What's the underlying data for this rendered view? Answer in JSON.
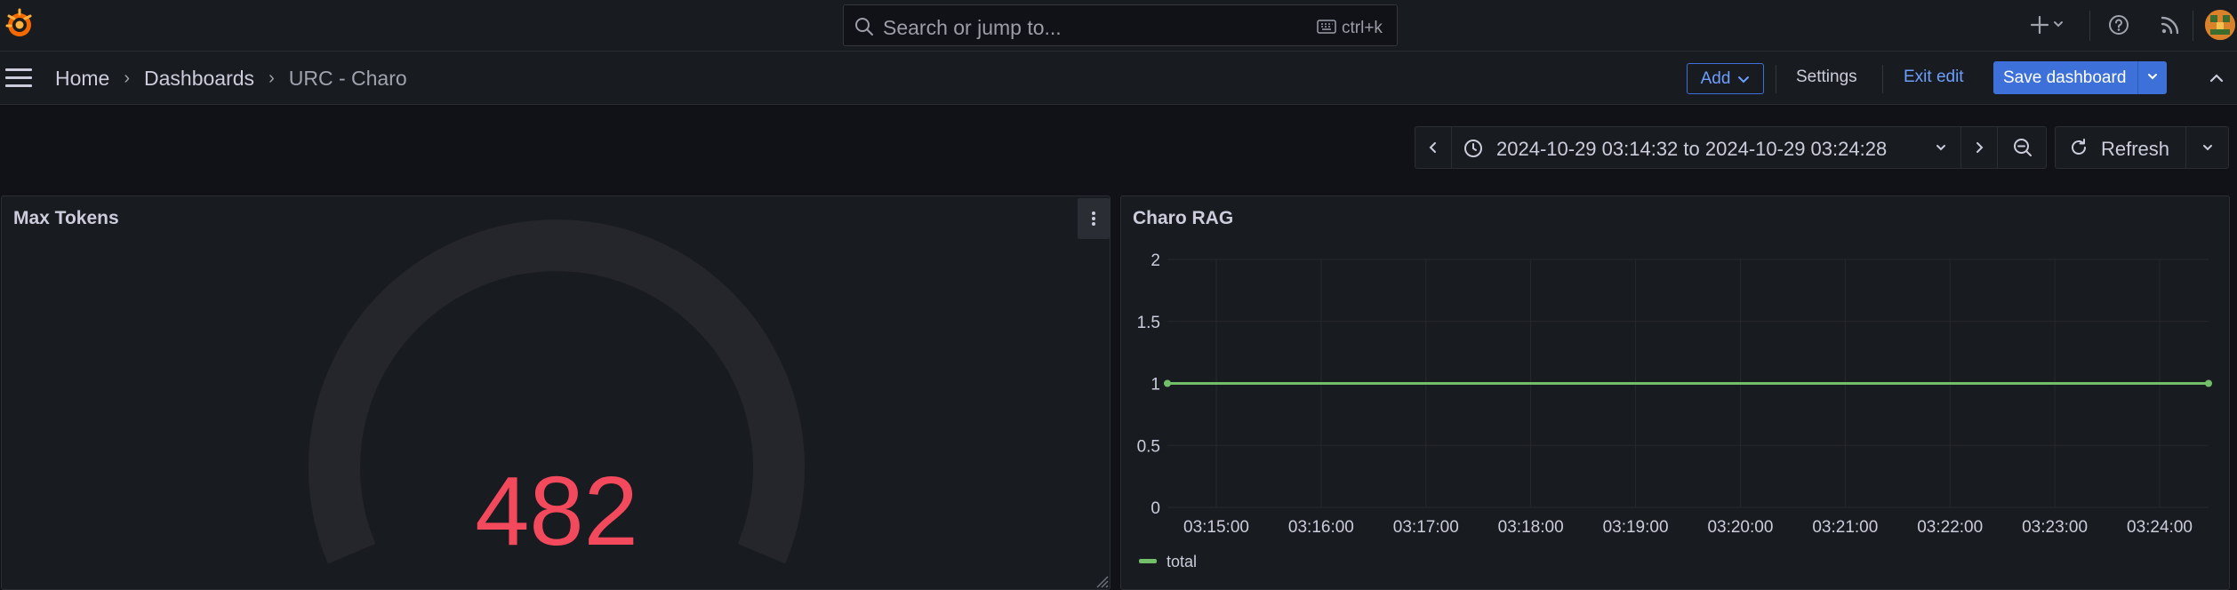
{
  "topbar": {
    "search_placeholder": "Search or jump to...",
    "search_shortcut": "ctrl+k",
    "icons": [
      "grafana-logo-icon",
      "search-icon",
      "keyboard-icon",
      "plus-icon",
      "chevron-down-icon",
      "help-icon",
      "rss-icon",
      "avatar"
    ]
  },
  "navbar": {
    "breadcrumb": [
      "Home",
      "Dashboards",
      "URC - Charo"
    ],
    "add_label": "Add",
    "settings_label": "Settings",
    "exit_edit_label": "Exit edit",
    "save_label": "Save dashboard"
  },
  "controls": {
    "time_from": "2024-10-29 03:14:32",
    "time_to_word": "to",
    "time_to": "2024-10-29 03:24:28",
    "refresh_label": "Refresh"
  },
  "panels": {
    "max_tokens": {
      "title": "Max Tokens",
      "value": "482",
      "value_color": "#f2495c"
    },
    "charo_rag": {
      "title": "Charo RAG"
    }
  },
  "colors": {
    "accent": "#3d71d9",
    "link": "#6e9fff",
    "series": "#73bf69",
    "gauge_value": "#f2495c"
  },
  "chart_data": {
    "type": "line",
    "title": "Charo RAG",
    "x": [
      "03:14:32",
      "03:24:28"
    ],
    "x_ticks": [
      "03:15:00",
      "03:16:00",
      "03:17:00",
      "03:18:00",
      "03:19:00",
      "03:20:00",
      "03:21:00",
      "03:22:00",
      "03:23:00",
      "03:24:00"
    ],
    "y_ticks": [
      "0",
      "0.5",
      "1",
      "1.5",
      "2"
    ],
    "ylim": [
      0,
      2
    ],
    "grid": true,
    "legend": "bottom-left",
    "series": [
      {
        "name": "total",
        "color": "#73bf69",
        "values": [
          1,
          1
        ]
      }
    ]
  }
}
